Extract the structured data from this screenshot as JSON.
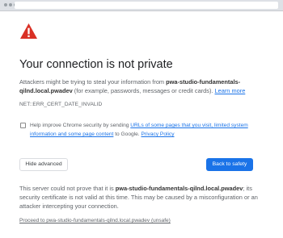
{
  "browser": {
    "icon": "window-dots-icon"
  },
  "page": {
    "icon": "warning-triangle-icon",
    "title": "Your connection is not private",
    "desc_part1": "Attackers might be trying to steal your information from ",
    "host": "pwa-studio-fundamentals-qilnd.local.pwadev",
    "desc_part2": " (for example, passwords, messages or credit cards). ",
    "learn_more": "Learn more",
    "error_code": "NET::ERR_CERT_DATE_INVALID",
    "help_part1": "Help improve Chrome security by sending ",
    "help_link": "URLs of some pages that you visit, limited system information and some page content",
    "help_part2": " to Google. ",
    "privacy_link": "Privacy Policy",
    "hide_advanced": "Hide advanced",
    "back_to_safety": "Back to safety",
    "details_part1": "This server could not prove that it is ",
    "details_host": "pwa-studio-fundamentals-qilnd.local.pwadev",
    "details_part2": "; its security certificate is not valid at this time. This may be caused by a misconfiguration or an attacker intercepting your connection.",
    "proceed_link": "Proceed to pwa-studio-fundamentals-qilnd.local.pwadev (unsafe)"
  },
  "colors": {
    "warning_red": "#d93025",
    "primary_blue": "#1a73e8",
    "browser_bar": "#dee1e6"
  }
}
